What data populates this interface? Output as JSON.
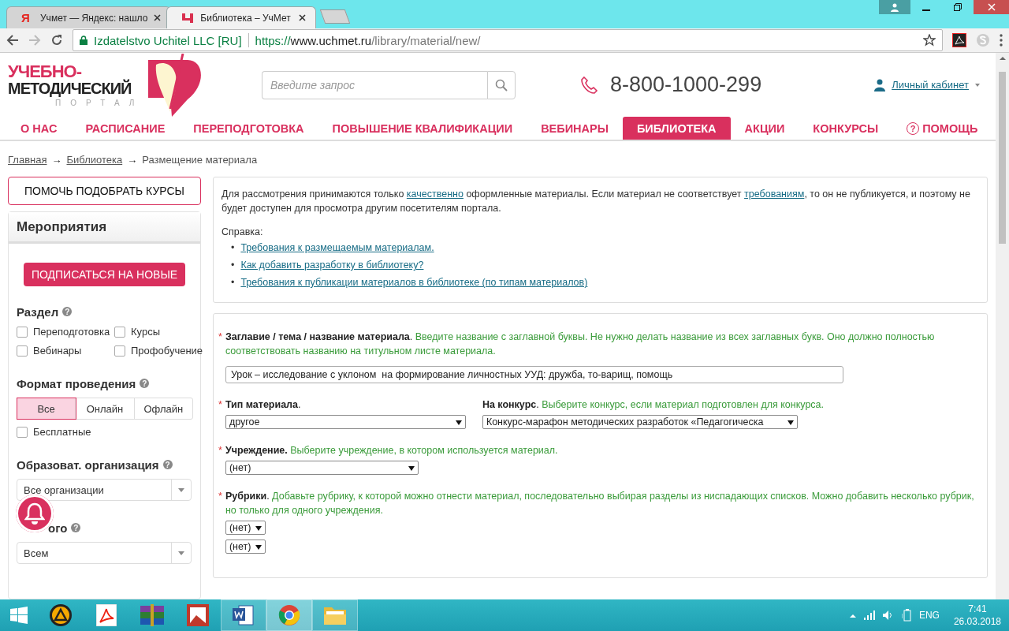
{
  "browser": {
    "tabs": [
      {
        "favicon": "Я",
        "title": "Учмет — Яндекс: нашло",
        "selected": false
      },
      {
        "title": "Библиотека – УчМет",
        "selected": true
      }
    ],
    "address": {
      "identity": "Izdatelstvo Uchitel LLC [RU]",
      "scheme": "https://",
      "host": "www.uchmet.ru",
      "path": "/library/material/new/"
    }
  },
  "header": {
    "logo": [
      "УЧЕБНО-",
      "МЕТОДИЧЕСКИЙ",
      "ПОРТАЛ"
    ],
    "search": {
      "placeholder": "Введите запрос"
    },
    "phone": "8-800-1000-299",
    "account": "Личный кабинет"
  },
  "nav": [
    {
      "label": "О НАС",
      "selected": false
    },
    {
      "label": "РАСПИСАНИЕ",
      "selected": false
    },
    {
      "label": "ПЕРЕПОДГОТОВКА",
      "selected": false
    },
    {
      "label": "ПОВЫШЕНИЕ КВАЛИФИКАЦИИ",
      "selected": false
    },
    {
      "label": "ВЕБИНАРЫ",
      "selected": false
    },
    {
      "label": "БИБЛИОТЕКА",
      "selected": true
    },
    {
      "label": "АКЦИИ",
      "selected": false
    },
    {
      "label": "КОНКУРСЫ",
      "selected": false
    },
    {
      "label": "ПОМОЩЬ",
      "icon": "?",
      "selected": false
    }
  ],
  "breadcrumbs": [
    {
      "text": "Главная",
      "kind": "link"
    },
    {
      "text": "→",
      "kind": "separator"
    },
    {
      "text": "Библиотека",
      "kind": "link"
    },
    {
      "text": "→",
      "kind": "separator"
    },
    {
      "text": "Размещение материала",
      "kind": "current"
    }
  ],
  "sidebar": {
    "pick_button": "ПОМОЧЬ ПОДОБРАТЬ КУРСЫ",
    "title": "Мероприятия",
    "subscribe_button": "ПОДПИСАТЬСЯ НА НОВЫЕ",
    "sections": [
      {
        "title": "Раздел",
        "help": "?",
        "kind": "checkgrid",
        "options": [
          {
            "label": "Переподготовка",
            "checked": false
          },
          {
            "label": "Курсы",
            "checked": false
          },
          {
            "label": "Вебинары",
            "checked": false
          },
          {
            "label": "Профобучение",
            "checked": false
          }
        ]
      },
      {
        "title": "Формат проведения",
        "help": "?",
        "kind": "segments",
        "options": [
          {
            "label": "Все",
            "selected": true
          },
          {
            "label": "Онлайн",
            "selected": false
          },
          {
            "label": "Офлайн",
            "selected": false
          }
        ],
        "checkbox": {
          "label": "Бесплатные",
          "checked": false
        }
      },
      {
        "title": "Образоват. организация",
        "help": "?",
        "kind": "select",
        "value": "Все организации"
      },
      {
        "title": "ого",
        "help": "?",
        "kind": "select",
        "value": "Всем"
      }
    ]
  },
  "notice": {
    "parts": [
      {
        "text": "Для рассмотрения принимаются только ",
        "link": false
      },
      {
        "text": "качественно",
        "link": true
      },
      {
        "text": " оформленные материалы. Если материал не соответствует ",
        "link": false
      },
      {
        "text": "требованиям",
        "link": true
      },
      {
        "text": ", то он не публикуется, и поэтому не будет доступен для просмотра другим посетителям портала.",
        "link": false
      }
    ],
    "reference_title": "Справка:",
    "marker": "•",
    "links": [
      "Требования к размещаемым материалам.",
      "Как добавить разработку в библиотеку?",
      "Требования к публикации материалов в библиотеке (по типам материалов)"
    ]
  },
  "form": {
    "rows": [
      {
        "fields": [
          {
            "mark": "*",
            "label": "**Заглавие / тема / название материала**.",
            "hint": "Введите название с заглавной буквы. Не нужно делать название из всех заглавных букв. Оно должно полностью соответствовать названию на титульном листе материала.",
            "kind": "text",
            "value": "Урок – исследование с уклоном  на формирование личностных УУД: дружба, то-варищ, помощь"
          }
        ]
      },
      {
        "fields": [
          {
            "mark": "*",
            "label": "**Тип материала**.",
            "kind": "select",
            "value": "другое"
          },
          {
            "label": "**На конкурс**.",
            "hint": "Выберите конкурс, если материал подготовлен для конкурса.",
            "kind": "select",
            "value": "Конкурс-марафон методических разработок «Педагогическа"
          }
        ]
      },
      {
        "fields": [
          {
            "mark": "*",
            "label": "**Учреждение.**",
            "hint": "Выберите учреждение, в котором используется материал.",
            "kind": "select",
            "value": "(нет)"
          }
        ]
      },
      {
        "fields": [
          {
            "mark": "*",
            "label": "**Рубрики**.",
            "hint": "Добавьте рубрику, к которой можно отнести материал, последовательно выбирая разделы из ниспадающих списков. Можно добавить несколько рубрик, но только для одного учреждения.",
            "kind": "select_list",
            "values": [
              "(нет)",
              "(нет)"
            ]
          }
        ]
      }
    ]
  },
  "taskbar": {
    "apps": [
      {
        "kind": "player",
        "open": false,
        "selected": false
      },
      {
        "kind": "pdf",
        "open": false,
        "selected": false
      },
      {
        "kind": "archiver",
        "open": false,
        "selected": false
      },
      {
        "kind": "image",
        "open": false,
        "selected": false
      },
      {
        "kind": "word",
        "open": true,
        "selected": false
      },
      {
        "kind": "browser",
        "open": true,
        "selected": true
      },
      {
        "kind": "folder",
        "open": true,
        "selected": false
      }
    ],
    "language": "ENG",
    "time": "7:41",
    "date": "26.03.2018"
  }
}
